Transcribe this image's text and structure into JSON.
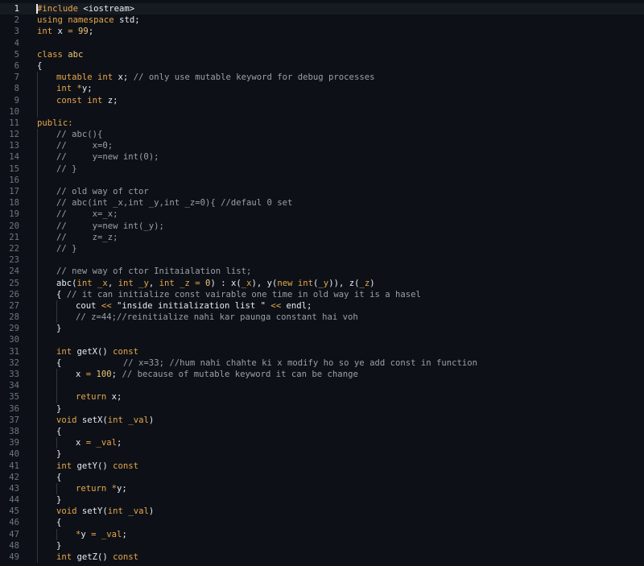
{
  "editor": {
    "active_line": 1,
    "lines": [
      {
        "n": "1",
        "indent": 0,
        "tokens": [
          [
            "pp",
            "#include "
          ],
          [
            "plain",
            "<iostream>"
          ]
        ]
      },
      {
        "n": "2",
        "indent": 0,
        "tokens": [
          [
            "kw",
            "using namespace "
          ],
          [
            "plain",
            "std;"
          ]
        ]
      },
      {
        "n": "3",
        "indent": 0,
        "tokens": [
          [
            "type",
            "int "
          ],
          [
            "plain",
            "x "
          ],
          [
            "op",
            "= "
          ],
          [
            "num",
            "99"
          ],
          [
            "plain",
            ";"
          ]
        ]
      },
      {
        "n": "4",
        "indent": 0,
        "tokens": []
      },
      {
        "n": "5",
        "indent": 0,
        "tokens": [
          [
            "kw",
            "class "
          ],
          [
            "cls",
            "abc"
          ]
        ]
      },
      {
        "n": "6",
        "indent": 0,
        "tokens": [
          [
            "plain",
            "{"
          ]
        ]
      },
      {
        "n": "7",
        "indent": 1,
        "tokens": [
          [
            "kw",
            "mutable "
          ],
          [
            "type",
            "int "
          ],
          [
            "plain",
            "x; "
          ],
          [
            "com",
            "// only use mutable keyword for debug processes"
          ]
        ]
      },
      {
        "n": "8",
        "indent": 1,
        "tokens": [
          [
            "type",
            "int "
          ],
          [
            "op",
            "*"
          ],
          [
            "plain",
            "y;"
          ]
        ]
      },
      {
        "n": "9",
        "indent": 1,
        "tokens": [
          [
            "kw",
            "const "
          ],
          [
            "type",
            "int "
          ],
          [
            "plain",
            "z;"
          ]
        ]
      },
      {
        "n": "10",
        "indent": 1,
        "tokens": []
      },
      {
        "n": "11",
        "indent": 0,
        "tokens": [
          [
            "kw",
            "public:"
          ]
        ]
      },
      {
        "n": "12",
        "indent": 1,
        "tokens": [
          [
            "com",
            "// abc(){"
          ]
        ]
      },
      {
        "n": "13",
        "indent": 1,
        "tokens": [
          [
            "com",
            "//     x=0;"
          ]
        ]
      },
      {
        "n": "14",
        "indent": 1,
        "tokens": [
          [
            "com",
            "//     y=new int(0);"
          ]
        ]
      },
      {
        "n": "15",
        "indent": 1,
        "tokens": [
          [
            "com",
            "// }"
          ]
        ]
      },
      {
        "n": "16",
        "indent": 1,
        "tokens": []
      },
      {
        "n": "17",
        "indent": 1,
        "tokens": [
          [
            "com",
            "// old way of ctor"
          ]
        ]
      },
      {
        "n": "18",
        "indent": 1,
        "tokens": [
          [
            "com",
            "// abc(int _x,int _y,int _z=0){ //defaul 0 set"
          ]
        ]
      },
      {
        "n": "19",
        "indent": 1,
        "tokens": [
          [
            "com",
            "//     x=_x;"
          ]
        ]
      },
      {
        "n": "20",
        "indent": 1,
        "tokens": [
          [
            "com",
            "//     y=new int(_y);"
          ]
        ]
      },
      {
        "n": "21",
        "indent": 1,
        "tokens": [
          [
            "com",
            "//     z=_z;"
          ]
        ]
      },
      {
        "n": "22",
        "indent": 1,
        "tokens": [
          [
            "com",
            "// }"
          ]
        ]
      },
      {
        "n": "23",
        "indent": 1,
        "tokens": []
      },
      {
        "n": "24",
        "indent": 1,
        "tokens": [
          [
            "com",
            "// new way of ctor Initaialation list;"
          ]
        ]
      },
      {
        "n": "25",
        "indent": 1,
        "tokens": [
          [
            "fn",
            "abc"
          ],
          [
            "plain",
            "("
          ],
          [
            "type",
            "int "
          ],
          [
            "var",
            "_x"
          ],
          [
            "plain",
            ", "
          ],
          [
            "type",
            "int "
          ],
          [
            "var",
            "_y"
          ],
          [
            "plain",
            ", "
          ],
          [
            "type",
            "int "
          ],
          [
            "var",
            "_z "
          ],
          [
            "op",
            "= "
          ],
          [
            "num",
            "0"
          ],
          [
            "plain",
            ") : x("
          ],
          [
            "var",
            "_x"
          ],
          [
            "plain",
            "), y("
          ],
          [
            "kw",
            "new "
          ],
          [
            "type",
            "int"
          ],
          [
            "plain",
            "("
          ],
          [
            "var",
            "_y"
          ],
          [
            "plain",
            ")), z("
          ],
          [
            "var",
            "_z"
          ],
          [
            "plain",
            ")"
          ]
        ]
      },
      {
        "n": "26",
        "indent": 1,
        "tokens": [
          [
            "plain",
            "{ "
          ],
          [
            "com",
            "// it can initialize const vairable one time in old way it is a hasel"
          ]
        ]
      },
      {
        "n": "27",
        "indent": 2,
        "tokens": [
          [
            "plain",
            "cout "
          ],
          [
            "op",
            "<< "
          ],
          [
            "str",
            "\"inside initialization list \" "
          ],
          [
            "op",
            "<< "
          ],
          [
            "plain",
            "endl;"
          ]
        ]
      },
      {
        "n": "28",
        "indent": 2,
        "tokens": [
          [
            "com",
            "// z=44;//reinitialize nahi kar paunga constant hai voh"
          ]
        ]
      },
      {
        "n": "29",
        "indent": 1,
        "tokens": [
          [
            "plain",
            "}"
          ]
        ]
      },
      {
        "n": "30",
        "indent": 1,
        "tokens": []
      },
      {
        "n": "31",
        "indent": 1,
        "tokens": [
          [
            "type",
            "int "
          ],
          [
            "fn",
            "getX"
          ],
          [
            "plain",
            "() "
          ],
          [
            "kw",
            "const"
          ]
        ]
      },
      {
        "n": "32",
        "indent": 1,
        "tokens": [
          [
            "plain",
            "{            "
          ],
          [
            "com",
            "// x=33; //hum nahi chahte ki x modify ho so ye add const in function"
          ]
        ]
      },
      {
        "n": "33",
        "indent": 2,
        "tokens": [
          [
            "plain",
            "x "
          ],
          [
            "op",
            "= "
          ],
          [
            "num",
            "100"
          ],
          [
            "plain",
            "; "
          ],
          [
            "com",
            "// because of mutable keyword it can be change"
          ]
        ]
      },
      {
        "n": "34",
        "indent": 2,
        "tokens": []
      },
      {
        "n": "35",
        "indent": 2,
        "tokens": [
          [
            "kw",
            "return "
          ],
          [
            "plain",
            "x;"
          ]
        ]
      },
      {
        "n": "36",
        "indent": 1,
        "tokens": [
          [
            "plain",
            "}"
          ]
        ]
      },
      {
        "n": "37",
        "indent": 1,
        "tokens": [
          [
            "type",
            "void "
          ],
          [
            "fn",
            "setX"
          ],
          [
            "plain",
            "("
          ],
          [
            "type",
            "int "
          ],
          [
            "var",
            "_val"
          ],
          [
            "plain",
            ")"
          ]
        ]
      },
      {
        "n": "38",
        "indent": 1,
        "tokens": [
          [
            "plain",
            "{"
          ]
        ]
      },
      {
        "n": "39",
        "indent": 2,
        "tokens": [
          [
            "plain",
            "x "
          ],
          [
            "op",
            "= "
          ],
          [
            "var",
            "_val"
          ],
          [
            "plain",
            ";"
          ]
        ]
      },
      {
        "n": "40",
        "indent": 1,
        "tokens": [
          [
            "plain",
            "}"
          ]
        ]
      },
      {
        "n": "41",
        "indent": 1,
        "tokens": [
          [
            "type",
            "int "
          ],
          [
            "fn",
            "getY"
          ],
          [
            "plain",
            "() "
          ],
          [
            "kw",
            "const"
          ]
        ]
      },
      {
        "n": "42",
        "indent": 1,
        "tokens": [
          [
            "plain",
            "{"
          ]
        ]
      },
      {
        "n": "43",
        "indent": 2,
        "tokens": [
          [
            "kw",
            "return "
          ],
          [
            "op",
            "*"
          ],
          [
            "plain",
            "y;"
          ]
        ]
      },
      {
        "n": "44",
        "indent": 1,
        "tokens": [
          [
            "plain",
            "}"
          ]
        ]
      },
      {
        "n": "45",
        "indent": 1,
        "tokens": [
          [
            "type",
            "void "
          ],
          [
            "fn",
            "setY"
          ],
          [
            "plain",
            "("
          ],
          [
            "type",
            "int "
          ],
          [
            "var",
            "_val"
          ],
          [
            "plain",
            ")"
          ]
        ]
      },
      {
        "n": "46",
        "indent": 1,
        "tokens": [
          [
            "plain",
            "{"
          ]
        ]
      },
      {
        "n": "47",
        "indent": 2,
        "tokens": [
          [
            "op",
            "*"
          ],
          [
            "plain",
            "y "
          ],
          [
            "op",
            "= "
          ],
          [
            "var",
            "_val"
          ],
          [
            "plain",
            ";"
          ]
        ]
      },
      {
        "n": "48",
        "indent": 1,
        "tokens": [
          [
            "plain",
            "}"
          ]
        ]
      },
      {
        "n": "49",
        "indent": 1,
        "tokens": [
          [
            "type",
            "int "
          ],
          [
            "fn",
            "getZ"
          ],
          [
            "plain",
            "() "
          ],
          [
            "kw",
            "const"
          ]
        ]
      }
    ]
  }
}
